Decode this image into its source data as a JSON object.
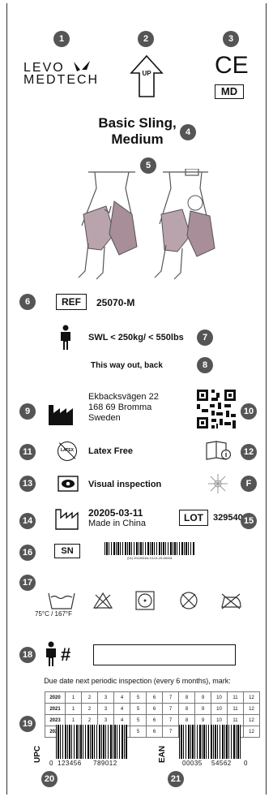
{
  "brand": {
    "line1": "LEVO",
    "line2": "MEDTECH"
  },
  "up_label": "UP",
  "ce_mark": "CE",
  "md_mark": "MD",
  "product": {
    "name_line1": "Basic Sling,",
    "name_line2": "Medium"
  },
  "ref": {
    "label": "REF",
    "value": "25070-M"
  },
  "swl": "SWL < 250kg/ < 550lbs",
  "exit_text": "This way out, back",
  "manufacturer": {
    "street": "Ekbacksvägen 22",
    "city": "168 69 Bromma",
    "country": "Sweden"
  },
  "latex": {
    "icon_text": "LATEX",
    "text": "Latex Free"
  },
  "visual_inspection": "Visual inspection",
  "f_mark": "F",
  "manufacture": {
    "date": "20205-03-11",
    "origin": "Made in China"
  },
  "lot": {
    "label": "LOT",
    "value": "329540"
  },
  "serial": {
    "label": "SN",
    "barcode_text": "(01) 20128164-13-01-25-00001"
  },
  "wash_temp": "75°C / 167°F",
  "hash_symbol": "#",
  "inspection_note": "Due date next periodic inspection (every 6 months), mark:",
  "inspection_grid": {
    "years": [
      "2020",
      "2021",
      "2023",
      "2024"
    ],
    "months": [
      "1",
      "2",
      "3",
      "4",
      "5",
      "6",
      "7",
      "8",
      "9",
      "10",
      "11",
      "12"
    ]
  },
  "upc": {
    "label": "UPC",
    "digits_left": "0",
    "digits_a": "123456",
    "digits_b": "789012"
  },
  "ean": {
    "label": "EAN",
    "digits_a": "00035",
    "digits_b": "54562",
    "digit_right": "0"
  },
  "badges": [
    "1",
    "2",
    "3",
    "4",
    "5",
    "6",
    "7",
    "8",
    "9",
    "10",
    "11",
    "12",
    "13",
    "14",
    "15",
    "16",
    "17",
    "18",
    "19",
    "20",
    "21"
  ]
}
